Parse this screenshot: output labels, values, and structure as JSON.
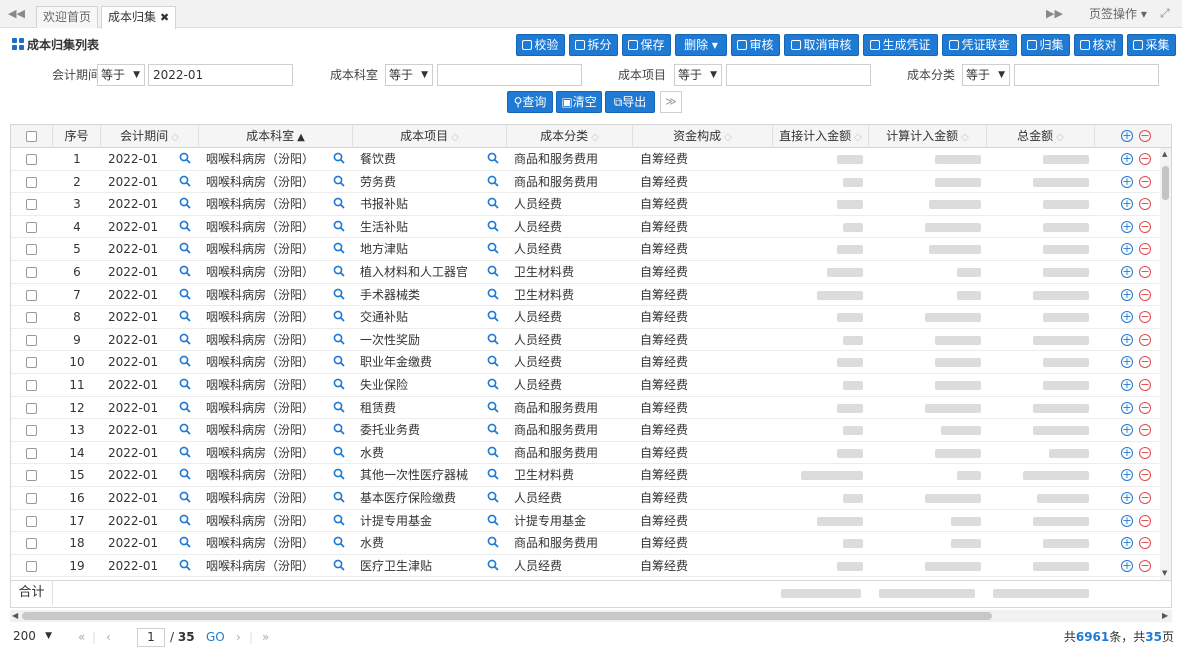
{
  "tabs": {
    "items": [
      {
        "label": "欢迎首页",
        "active": false
      },
      {
        "label": "成本归集",
        "active": true
      }
    ],
    "close_glyph": "✖",
    "ops_label": "页签操作"
  },
  "list_title": "成本归集列表",
  "toolbar": {
    "buttons": [
      "校验",
      "拆分",
      "保存",
      "删除",
      "审核",
      "取消审核",
      "生成凭证",
      "凭证联查",
      "归集",
      "核对",
      "采集"
    ]
  },
  "filters": [
    {
      "label": "会计期间",
      "op": "等于",
      "value": ""
    },
    {
      "label": "成本科室",
      "op": "等于",
      "value": ""
    },
    {
      "label": "成本项目",
      "op": "等于",
      "value": ""
    },
    {
      "label": "成本分类",
      "op": "等于",
      "value": ""
    }
  ],
  "filter_period_value": "2022-01",
  "query_buttons": [
    "查询",
    "清空",
    "导出"
  ],
  "columns": [
    "序号",
    "会计期间",
    "成本科室",
    "成本项目",
    "成本分类",
    "资金构成",
    "直接计入金额",
    "计算计入金额",
    "总金额"
  ],
  "rows": [
    {
      "no": "1",
      "period": "2022-01",
      "dept": "咽喉科病房（汾阳）",
      "item": "餐饮费",
      "cat": "商品和服务费用",
      "fund": "自筹经费"
    },
    {
      "no": "2",
      "period": "2022-01",
      "dept": "咽喉科病房（汾阳）",
      "item": "劳务费",
      "cat": "商品和服务费用",
      "fund": "自筹经费"
    },
    {
      "no": "3",
      "period": "2022-01",
      "dept": "咽喉科病房（汾阳）",
      "item": "书报补贴",
      "cat": "人员经费",
      "fund": "自筹经费"
    },
    {
      "no": "4",
      "period": "2022-01",
      "dept": "咽喉科病房（汾阳）",
      "item": "生活补贴",
      "cat": "人员经费",
      "fund": "自筹经费"
    },
    {
      "no": "5",
      "period": "2022-01",
      "dept": "咽喉科病房（汾阳）",
      "item": "地方津贴",
      "cat": "人员经费",
      "fund": "自筹经费"
    },
    {
      "no": "6",
      "period": "2022-01",
      "dept": "咽喉科病房（汾阳）",
      "item": "植入材料和人工器官",
      "cat": "卫生材料费",
      "fund": "自筹经费"
    },
    {
      "no": "7",
      "period": "2022-01",
      "dept": "咽喉科病房（汾阳）",
      "item": "手术器械类",
      "cat": "卫生材料费",
      "fund": "自筹经费"
    },
    {
      "no": "8",
      "period": "2022-01",
      "dept": "咽喉科病房（汾阳）",
      "item": "交通补贴",
      "cat": "人员经费",
      "fund": "自筹经费"
    },
    {
      "no": "9",
      "period": "2022-01",
      "dept": "咽喉科病房（汾阳）",
      "item": "一次性奖励",
      "cat": "人员经费",
      "fund": "自筹经费"
    },
    {
      "no": "10",
      "period": "2022-01",
      "dept": "咽喉科病房（汾阳）",
      "item": "职业年金缴费",
      "cat": "人员经费",
      "fund": "自筹经费"
    },
    {
      "no": "11",
      "period": "2022-01",
      "dept": "咽喉科病房（汾阳）",
      "item": "失业保险",
      "cat": "人员经费",
      "fund": "自筹经费"
    },
    {
      "no": "12",
      "period": "2022-01",
      "dept": "咽喉科病房（汾阳）",
      "item": "租赁费",
      "cat": "商品和服务费用",
      "fund": "自筹经费"
    },
    {
      "no": "13",
      "period": "2022-01",
      "dept": "咽喉科病房（汾阳）",
      "item": "委托业务费",
      "cat": "商品和服务费用",
      "fund": "自筹经费"
    },
    {
      "no": "14",
      "period": "2022-01",
      "dept": "咽喉科病房（汾阳）",
      "item": "水费",
      "cat": "商品和服务费用",
      "fund": "自筹经费"
    },
    {
      "no": "15",
      "period": "2022-01",
      "dept": "咽喉科病房（汾阳）",
      "item": "其他一次性医疗器械",
      "cat": "卫生材料费",
      "fund": "自筹经费"
    },
    {
      "no": "16",
      "period": "2022-01",
      "dept": "咽喉科病房（汾阳）",
      "item": "基本医疗保险缴费",
      "cat": "人员经费",
      "fund": "自筹经费"
    },
    {
      "no": "17",
      "period": "2022-01",
      "dept": "咽喉科病房（汾阳）",
      "item": "计提专用基金",
      "cat": "计提专用基金",
      "fund": "自筹经费"
    },
    {
      "no": "18",
      "period": "2022-01",
      "dept": "咽喉科病房（汾阳）",
      "item": "水费",
      "cat": "商品和服务费用",
      "fund": "自筹经费"
    },
    {
      "no": "19",
      "period": "2022-01",
      "dept": "咽喉科病房（汾阳）",
      "item": "医疗卫生津贴",
      "cat": "人员经费",
      "fund": "自筹经费"
    }
  ],
  "sum_label": "合计",
  "pager": {
    "page_size": "200",
    "current_page": "1",
    "total_pages": "35",
    "go_label": "GO",
    "info_prefix": "共",
    "total_records": "6961",
    "info_mid": "条，共",
    "info_pages": "35",
    "info_suffix": "页"
  },
  "colors": {
    "primary": "#1f7ad4",
    "danger": "#e04848",
    "header_bg": "#f5f5f5"
  }
}
